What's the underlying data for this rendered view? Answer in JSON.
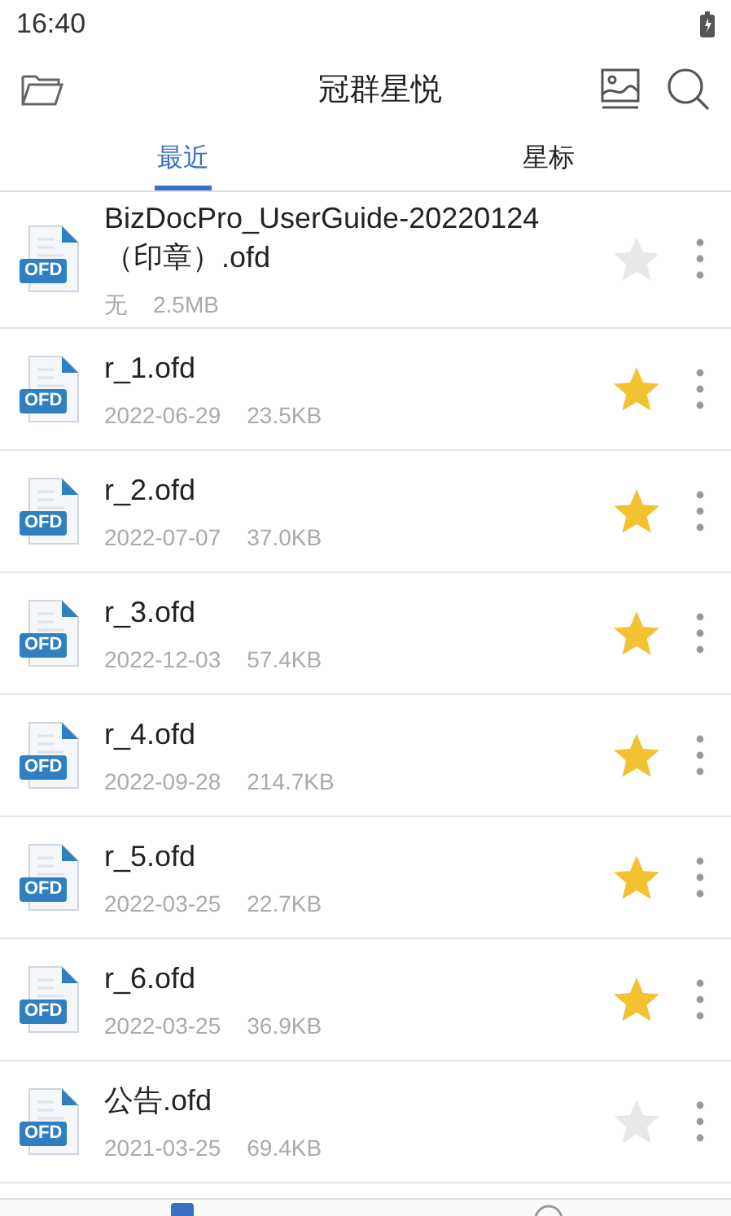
{
  "status_bar": {
    "time": "16:40"
  },
  "header": {
    "title": "冠群星悦"
  },
  "tabs": [
    {
      "label": "最近",
      "selected": true
    },
    {
      "label": "星标",
      "selected": false
    }
  ],
  "files": [
    {
      "name": "BizDocPro_UserGuide-20220124（印章）.ofd",
      "badge": "OFD",
      "date": "无",
      "size": "2.5MB",
      "starred": false
    },
    {
      "name": "r_1.ofd",
      "badge": "OFD",
      "date": "2022-06-29",
      "size": "23.5KB",
      "starred": true
    },
    {
      "name": "r_2.ofd",
      "badge": "OFD",
      "date": "2022-07-07",
      "size": "37.0KB",
      "starred": true
    },
    {
      "name": "r_3.ofd",
      "badge": "OFD",
      "date": "2022-12-03",
      "size": "57.4KB",
      "starred": true
    },
    {
      "name": "r_4.ofd",
      "badge": "OFD",
      "date": "2022-09-28",
      "size": "214.7KB",
      "starred": true
    },
    {
      "name": "r_5.ofd",
      "badge": "OFD",
      "date": "2022-03-25",
      "size": "22.7KB",
      "starred": true
    },
    {
      "name": "r_6.ofd",
      "badge": "OFD",
      "date": "2022-03-25",
      "size": "36.9KB",
      "starred": true
    },
    {
      "name": "公告.ofd",
      "badge": "OFD",
      "date": "2021-03-25",
      "size": "69.4KB",
      "starred": false
    }
  ],
  "bottom_nav": [
    {
      "selected": true
    },
    {
      "selected": false
    }
  ]
}
